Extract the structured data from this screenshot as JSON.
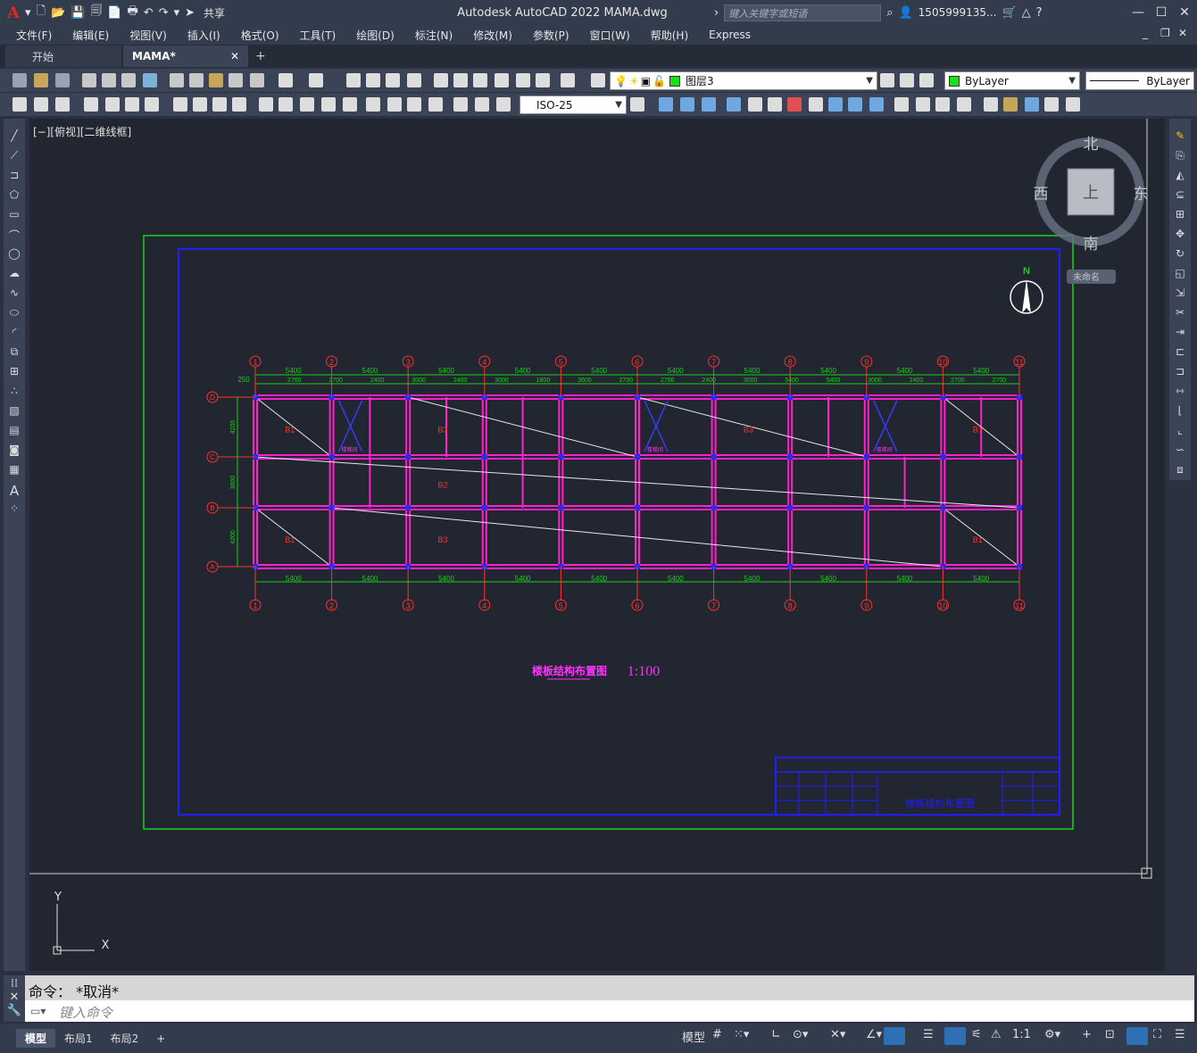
{
  "titlebar": {
    "share": "共享",
    "title": "Autodesk AutoCAD 2022    MAMA.dwg",
    "search_placeholder": "键入关键字或短语",
    "user": "1505999135...",
    "minimize": "—",
    "maximize": "☐",
    "close": "✕"
  },
  "menu": [
    "文件(F)",
    "编辑(E)",
    "视图(V)",
    "插入(I)",
    "格式(O)",
    "工具(T)",
    "绘图(D)",
    "标注(N)",
    "修改(M)",
    "参数(P)",
    "窗口(W)",
    "帮助(H)",
    "Express"
  ],
  "tabs": {
    "start": "开始",
    "active": "MAMA*",
    "close": "✕",
    "add": "+"
  },
  "toolbar": {
    "layer": "图层3",
    "color": "ByLayer",
    "linetype": "ByLayer",
    "dimstyle": "ISO-25"
  },
  "viewport": {
    "label": "[−][俯视][二维线框]",
    "viewcube": {
      "north": "北",
      "south": "南",
      "east": "东",
      "west": "西",
      "top": "上",
      "ucs": "未命名"
    },
    "north_arrow": "N",
    "ucs_x": "X",
    "ucs_y": "Y"
  },
  "drawing": {
    "title": "楼板结构布置图",
    "scale": "1:100",
    "axes_top": [
      "1",
      "2",
      "3",
      "4",
      "5",
      "6",
      "7",
      "8",
      "9",
      "10",
      "11"
    ],
    "axes_left": [
      "D",
      "C",
      "B",
      "A"
    ],
    "dims_top": [
      "5400",
      "5400",
      "5400",
      "5400",
      "5400",
      "5400",
      "5400",
      "5400",
      "5400",
      "5400"
    ],
    "dims_sub": [
      "2700",
      "2700",
      "2400",
      "3000",
      "2400",
      "3000",
      "1800",
      "3600",
      "2700",
      "2700",
      "2400",
      "3000",
      "5400",
      "5400",
      "3000",
      "2400",
      "2700",
      "2700"
    ],
    "dims_bottom": [
      "5400",
      "5400",
      "5400",
      "5400",
      "5400",
      "5400",
      "5400",
      "5400",
      "5400",
      "5400"
    ],
    "dims_left": [
      "4200",
      "3600",
      "4200"
    ],
    "dim_250": "250",
    "slabs": [
      "B1",
      "B3",
      "B3",
      "B1",
      "B2",
      "B3",
      "B1",
      "B1"
    ],
    "stairs": [
      "楼梯间",
      "楼梯间",
      "楼梯间"
    ],
    "title_block": "楼板结构布置图"
  },
  "command": {
    "history": "命令： *取消*",
    "placeholder": "键入命令"
  },
  "status": {
    "layouts": [
      "模型",
      "布局1",
      "布局2"
    ],
    "add": "+",
    "model": "模型",
    "scale": "1:1"
  }
}
